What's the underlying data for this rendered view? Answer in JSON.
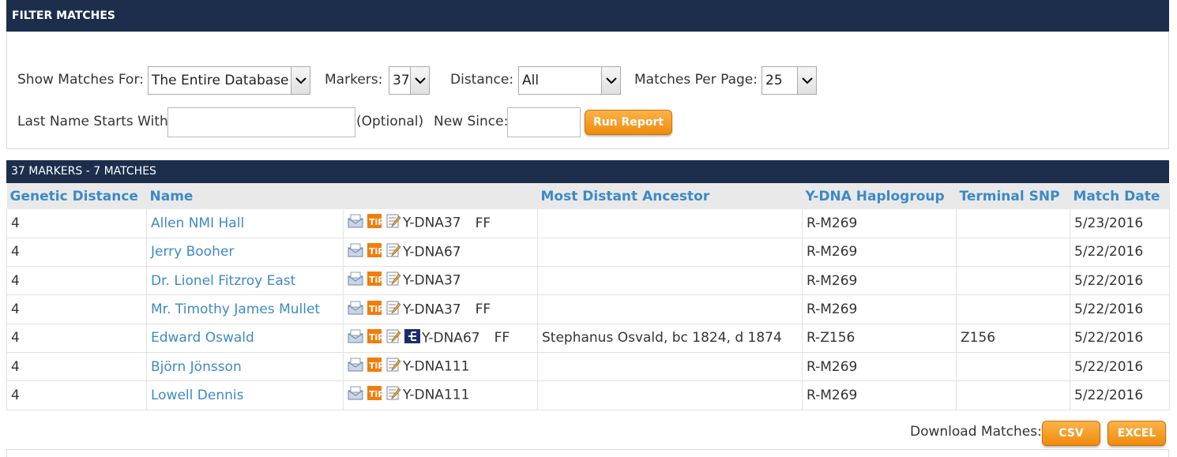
{
  "filter": {
    "title": "FILTER MATCHES",
    "show_matches_label": "Show Matches For:",
    "show_matches_value": "The Entire Database",
    "markers_label": "Markers:",
    "markers_value": "37",
    "distance_label": "Distance:",
    "distance_value": "All",
    "per_page_label": "Matches Per Page:",
    "per_page_value": "25",
    "last_name_label": "Last Name Starts With:",
    "last_name_value": "",
    "optional_label": "(Optional)",
    "new_since_label": "New Since:",
    "new_since_value": "",
    "run_report_label": "Run Report"
  },
  "results": {
    "bar_title": "37 MARKERS - 7 MATCHES",
    "columns": {
      "genetic_distance": "Genetic Distance",
      "name": "Name",
      "tests": "",
      "ancestor": "Most Distant Ancestor",
      "haplogroup": "Y-DNA Haplogroup",
      "terminal_snp": "Terminal SNP",
      "match_date": "Match Date"
    },
    "rows": [
      {
        "distance": "4",
        "name": "Allen NMI Hall",
        "test": "Y-DNA37",
        "ff": "FF",
        "tree": false,
        "ancestor": "",
        "haplogroup": "R-M269",
        "snp": "",
        "date": "5/23/2016"
      },
      {
        "distance": "4",
        "name": "Jerry Booher",
        "test": "Y-DNA67",
        "ff": "",
        "tree": false,
        "ancestor": "",
        "haplogroup": "R-M269",
        "snp": "",
        "date": "5/22/2016"
      },
      {
        "distance": "4",
        "name": "Dr. Lionel Fitzroy East",
        "test": "Y-DNA37",
        "ff": "",
        "tree": false,
        "ancestor": "",
        "haplogroup": "R-M269",
        "snp": "",
        "date": "5/22/2016"
      },
      {
        "distance": "4",
        "name": "Mr. Timothy James Mullet",
        "test": "Y-DNA37",
        "ff": "FF",
        "tree": false,
        "ancestor": "",
        "haplogroup": "R-M269",
        "snp": "",
        "date": "5/22/2016"
      },
      {
        "distance": "4",
        "name": "Edward Oswald",
        "test": "Y-DNA67",
        "ff": "FF",
        "tree": true,
        "ancestor": "Stephanus Osvald, bc 1824, d 1874",
        "haplogroup": "R-Z156",
        "snp": "Z156",
        "date": "5/22/2016"
      },
      {
        "distance": "4",
        "name": "Björn Jönsson",
        "test": "Y-DNA111",
        "ff": "",
        "tree": false,
        "ancestor": "",
        "haplogroup": "R-M269",
        "snp": "",
        "date": "5/22/2016"
      },
      {
        "distance": "4",
        "name": "Lowell Dennis",
        "test": "Y-DNA111",
        "ff": "",
        "tree": false,
        "ancestor": "",
        "haplogroup": "R-M269",
        "snp": "",
        "date": "5/22/2016"
      }
    ]
  },
  "download": {
    "label": "Download Matches:",
    "csv_label": "CSV",
    "excel_label": "EXCEL"
  },
  "icons": {
    "email": "email-icon",
    "tip": "tip-calculator-icon",
    "notes": "notes-icon",
    "tree": "family-tree-icon"
  },
  "colors": {
    "header_bg": "#1d2e4d",
    "link": "#3d8ac6",
    "button_orange": "#f08b0c"
  }
}
